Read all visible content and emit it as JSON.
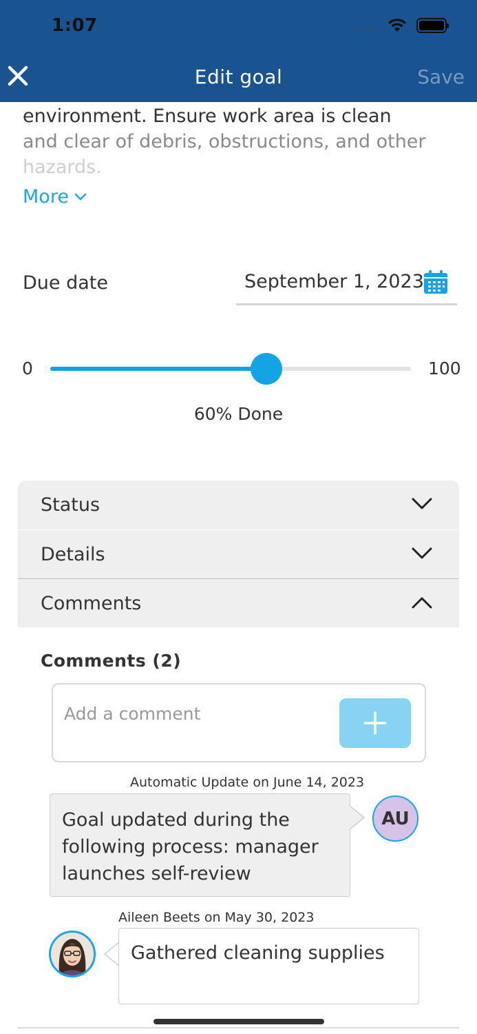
{
  "status_bar": {
    "time": "1:07"
  },
  "header": {
    "title": "Edit goal",
    "save_label": "Save"
  },
  "description": {
    "line1": "environment. Ensure work area is clean",
    "line2": "and clear of debris, obstructions, and other",
    "line3": "hazards.",
    "more_label": "More"
  },
  "due_date": {
    "label": "Due date",
    "value": "September 1, 2023"
  },
  "progress": {
    "min_label": "0",
    "max_label": "100",
    "value_fraction": 0.6,
    "caption": "60% Done"
  },
  "accordion": {
    "status_label": "Status",
    "details_label": "Details",
    "comments_label": "Comments"
  },
  "comments": {
    "heading": "Comments (2)",
    "input_placeholder": "Add a comment",
    "items": [
      {
        "meta": "Automatic Update on June 14, 2023",
        "text": "Goal updated during the following process: manager launches self-review",
        "avatar_initials": "AU"
      },
      {
        "meta": "Aileen Beets on May 30, 2023",
        "text": "Gathered cleaning supplies"
      }
    ]
  },
  "colors": {
    "header_bg": "#195491",
    "accent": "#12a4e4",
    "add_button": "#86d3f4",
    "avatar_bg": "#d5c3e8"
  }
}
